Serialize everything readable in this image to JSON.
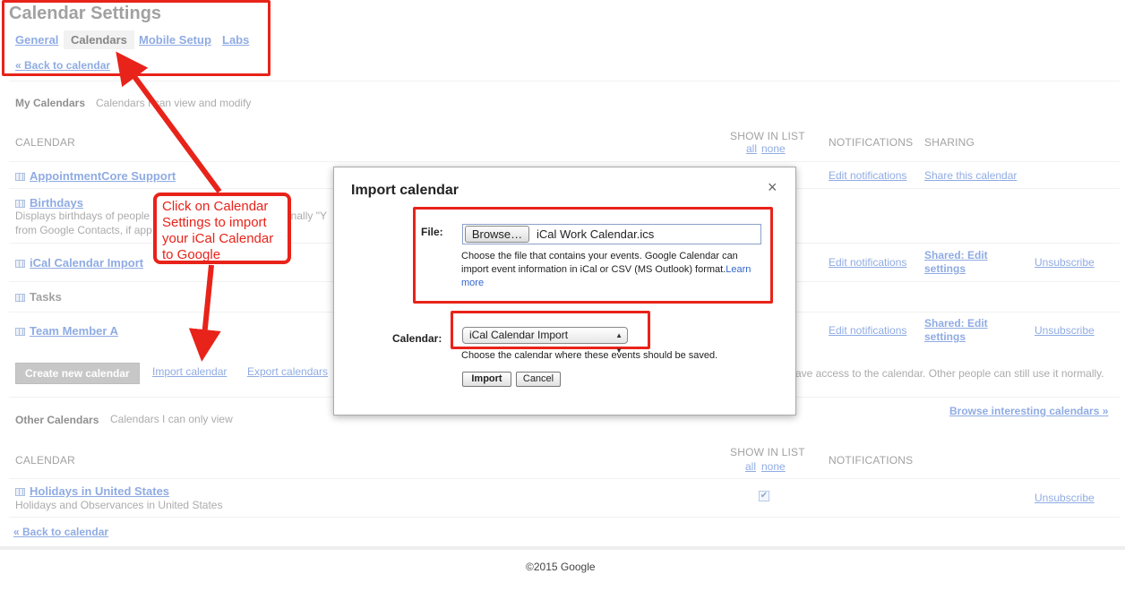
{
  "header": {
    "title": "Calendar Settings",
    "tabs": [
      {
        "label": "General"
      },
      {
        "label": "Calendars"
      },
      {
        "label": "Mobile Setup"
      },
      {
        "label": "Labs"
      }
    ],
    "back_link": "« Back to calendar"
  },
  "my_calendars": {
    "title": "My Calendars",
    "subtitle": "Calendars I can view and modify",
    "col_calendar": "CALENDAR",
    "col_show_in_list": "SHOW IN LIST",
    "col_all": "all",
    "col_none": "none",
    "col_notifications": "NOTIFICATIONS",
    "col_sharing": "SHARING",
    "rows": [
      {
        "name": "AppointmentCore Support",
        "notifications": "Edit notifications",
        "sharing": "Share this calendar",
        "unsubscribe": ""
      },
      {
        "name": "Birthdays",
        "desc1": "Displays birthdays of people",
        "desc1_tail": "onally \"Y",
        "desc2": "from Google Contacts, if app"
      },
      {
        "name": "iCal Calendar Import",
        "notifications": "Edit notifications",
        "sharing_1": "Shared: Edit",
        "sharing_2": "settings",
        "unsubscribe": "Unsubscribe"
      },
      {
        "name": "Tasks"
      },
      {
        "name": "Team Member A",
        "notifications": "Edit notifications",
        "sharing_1": "Shared: Edit",
        "sharing_2": "settings",
        "unsubscribe": "Unsubscribe"
      }
    ],
    "create_button": "Create new calendar",
    "import_link": "Import calendar",
    "export_link": "Export calendars",
    "note_tail": "r have access to the calendar. Other people can still use it normally."
  },
  "other_calendars": {
    "title": "Other Calendars",
    "subtitle": "Calendars I can only view",
    "browse_link": "Browse interesting calendars »",
    "col_calendar": "CALENDAR",
    "col_show_in_list": "SHOW IN LIST",
    "col_all": "all",
    "col_none": "none",
    "col_notifications": "NOTIFICATIONS",
    "rows": [
      {
        "name": "Holidays in United States",
        "desc": "Holidays and Observances in United States",
        "shown": true,
        "unsubscribe": "Unsubscribe"
      }
    ]
  },
  "bottom_back_link": "« Back to calendar",
  "footer": "©2015 Google",
  "callout": "Click on Calendar Settings to import your iCal Calendar to Google",
  "modal": {
    "title": "Import calendar",
    "close": "×",
    "file_label": "File:",
    "browse_button": "Browse…",
    "file_name": "iCal Work Calendar.ics",
    "file_help": "Choose the file that contains your events. Google Calendar can import event information in iCal or CSV (MS Outlook) format.",
    "learn_more": "Learn more",
    "calendar_label": "Calendar:",
    "calendar_selected": "iCal Calendar Import",
    "calendar_help": "Choose the calendar where these events should be saved.",
    "import_button": "Import",
    "cancel_button": "Cancel"
  },
  "colors": {
    "link": "#3366cc",
    "annotation_red": "#e8231a",
    "button_gray": "#999999"
  }
}
